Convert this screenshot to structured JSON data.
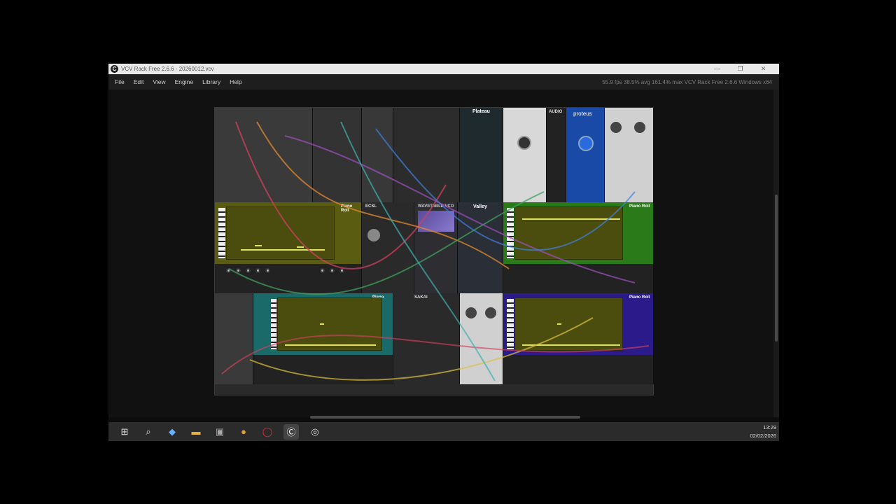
{
  "window": {
    "title": "VCV Rack Free 2.6.6 - 20260012.vcv",
    "controls": [
      "—",
      "❐",
      "✕"
    ]
  },
  "menubar": {
    "items": [
      "File",
      "Edit",
      "View",
      "Engine",
      "Library",
      "Help"
    ],
    "status": "55.9 fps  38.5% avg  161.4% max     VCV Rack Free 2.6.6 Windows x64"
  },
  "modules": {
    "plateau": "Plateau",
    "valley": "Valley",
    "proteus": "proteus",
    "audio": "AUDIO",
    "piano_roll": "Piano Roll",
    "wavetable": "WAVETABLE VCO",
    "sakai": "SAKAI",
    "ecsl": "ECSL"
  },
  "colors": {
    "accent": "#e0e060",
    "proteus_blue": "#1a4aa8",
    "piano_green": "#2a7a1a",
    "piano_blue": "#2a1a8a",
    "piano_teal": "#1a6a6a"
  },
  "taskbar": {
    "icons": [
      "windows-icon",
      "search-icon",
      "copilot-icon",
      "file-explorer-icon",
      "store-icon",
      "chrome-icon",
      "opera-icon",
      "vcv-rack-icon",
      "vcv-rack-alt-icon"
    ],
    "time": "13:29",
    "date": "02/02/2026"
  }
}
